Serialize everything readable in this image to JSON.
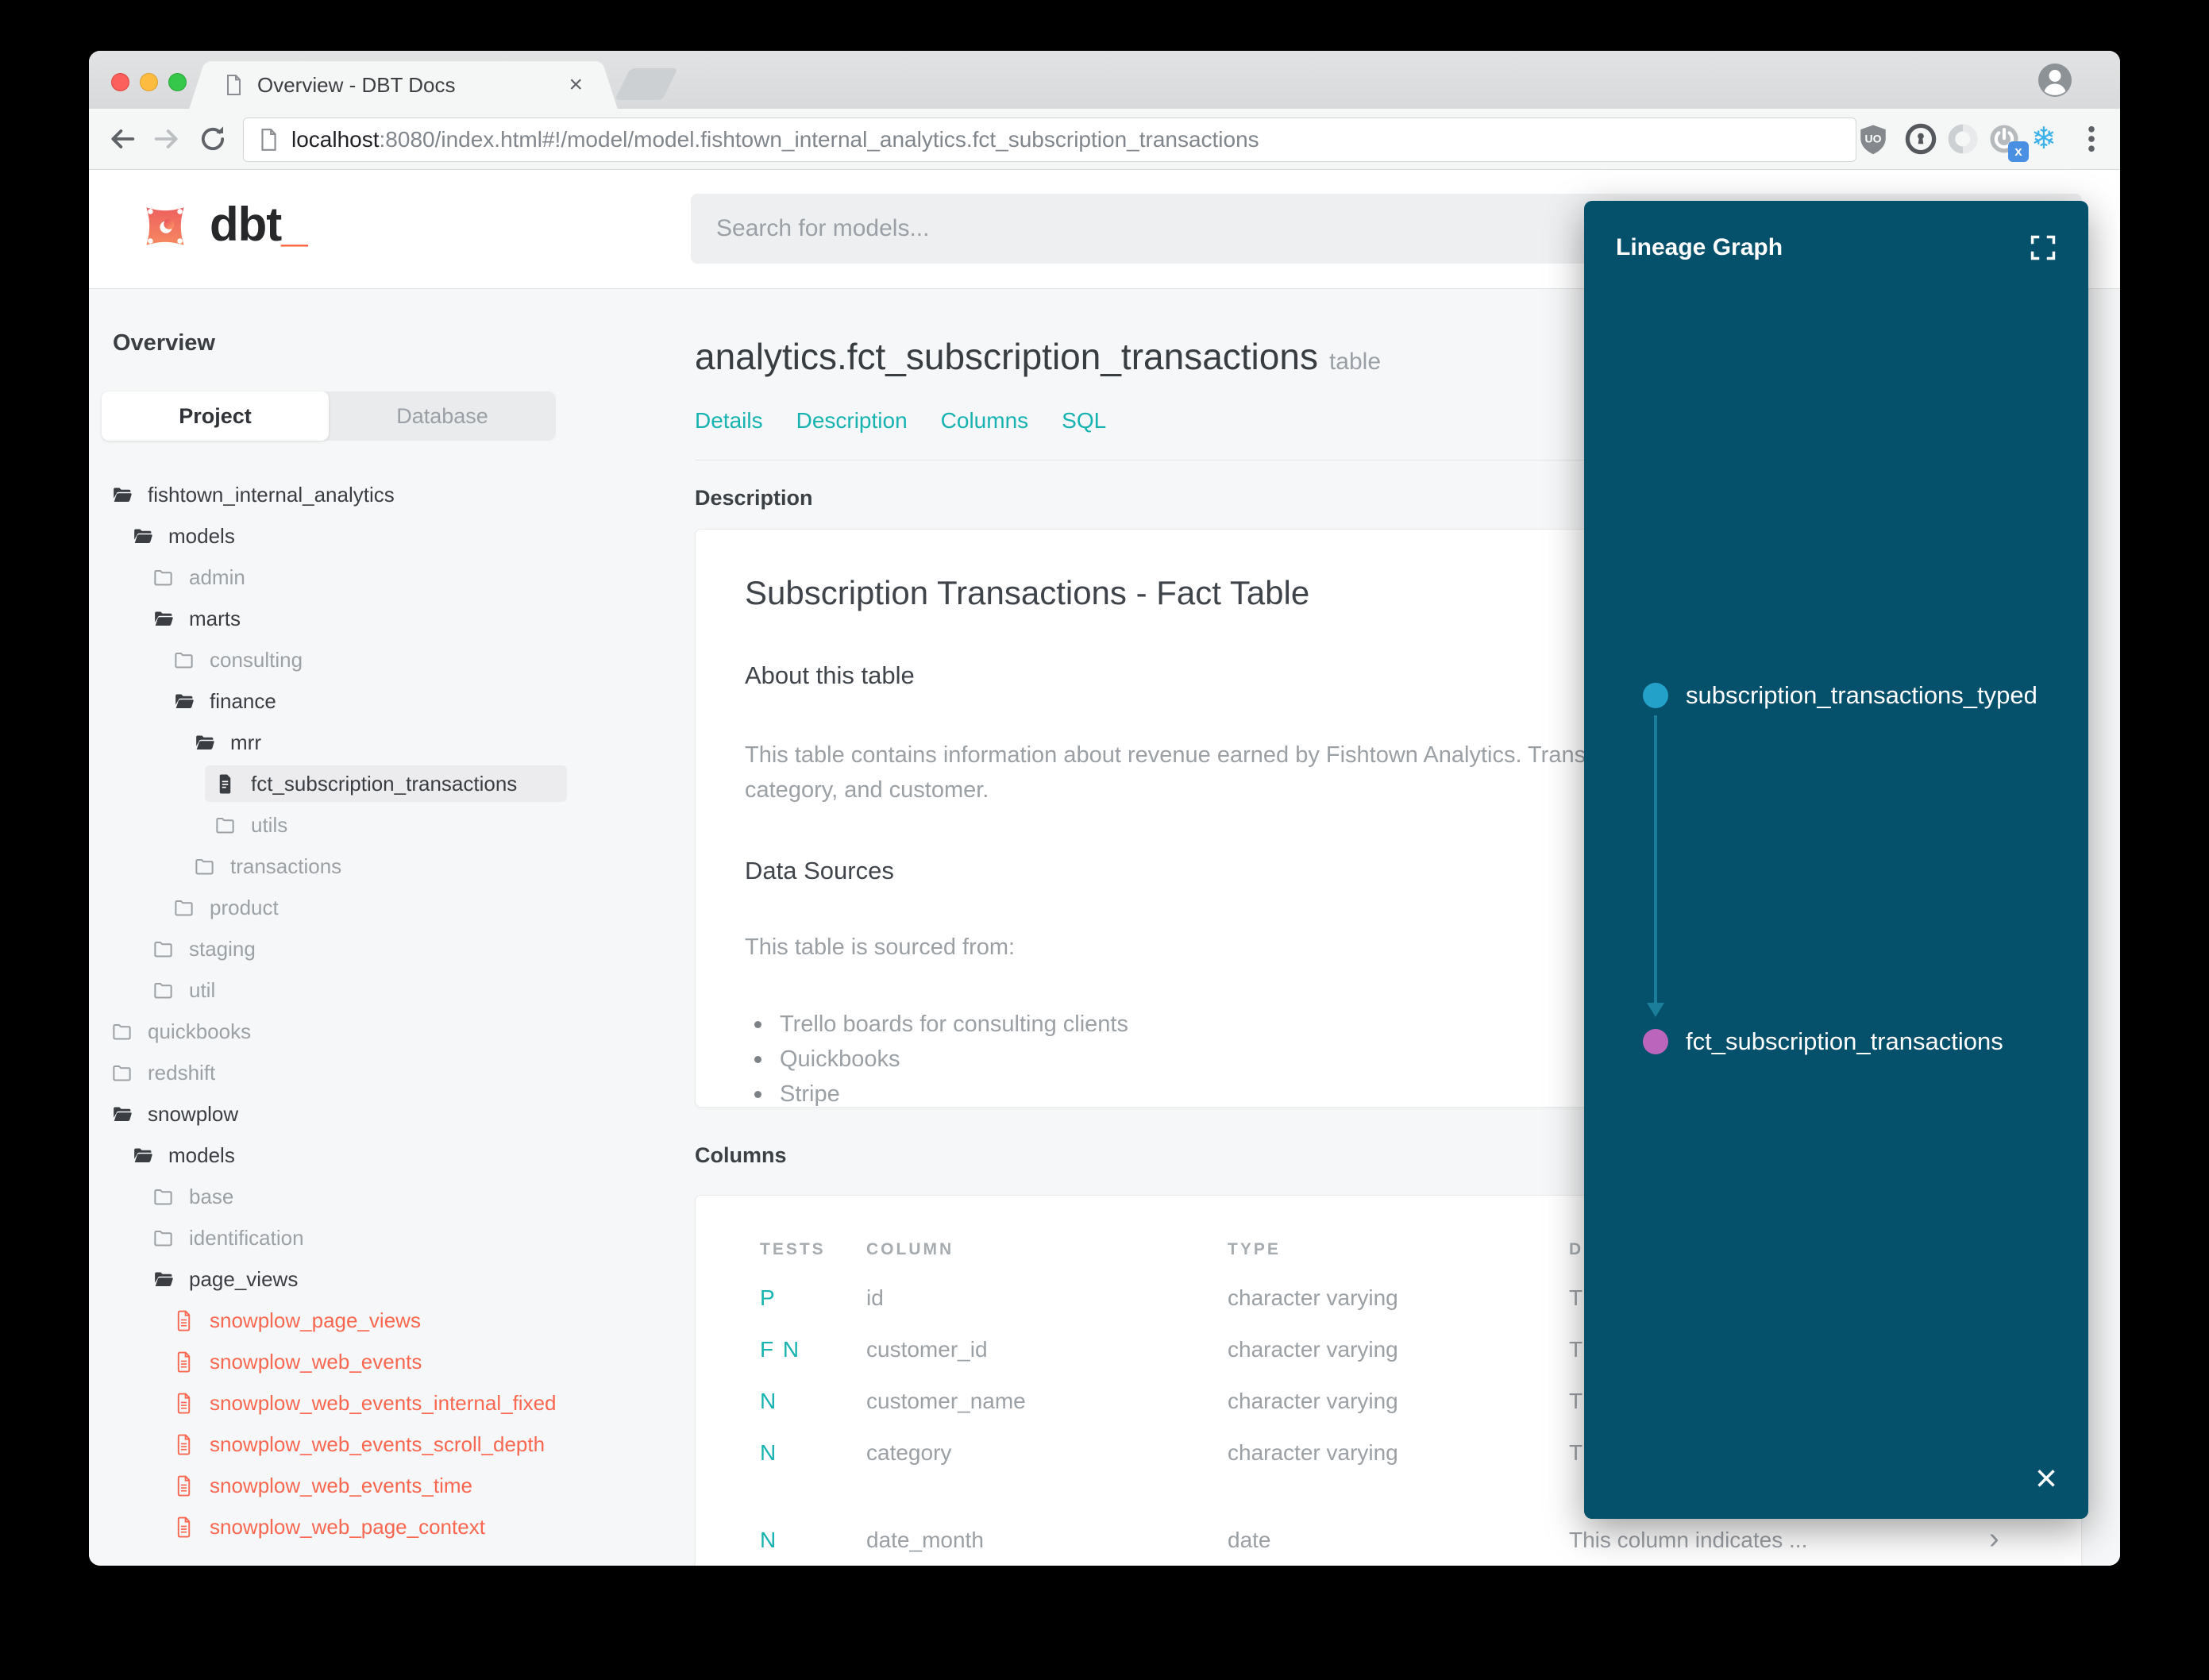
{
  "browser": {
    "tab": {
      "title": "Overview - DBT Docs",
      "close_glyph": "×"
    },
    "url": {
      "host": "localhost",
      "rest": ":8080/index.html#!/model/model.fishtown_internal_analytics.fct_subscription_transactions"
    },
    "extension_icons": [
      "ublock-shield-icon",
      "onepassword-icon",
      "opera-ring-icon",
      "power-blocker-icon",
      "snowflake-icon",
      "overflow-menu-icon"
    ]
  },
  "app": {
    "logo_text": "dbt",
    "logo_cursor": "_",
    "search_placeholder": "Search for models..."
  },
  "sidebar": {
    "heading": "Overview",
    "view_tabs": [
      {
        "label": "Project",
        "active": true
      },
      {
        "label": "Database",
        "active": false
      }
    ],
    "tree": [
      {
        "label": "fishtown_internal_analytics",
        "level": 0,
        "icon": "folder-open",
        "tone": "dark"
      },
      {
        "label": "models",
        "level": 1,
        "icon": "folder-open",
        "tone": "dark"
      },
      {
        "label": "admin",
        "level": 2,
        "icon": "folder",
        "tone": "muted"
      },
      {
        "label": "marts",
        "level": 2,
        "icon": "folder-open",
        "tone": "dark"
      },
      {
        "label": "consulting",
        "level": 3,
        "icon": "folder",
        "tone": "muted"
      },
      {
        "label": "finance",
        "level": 3,
        "icon": "folder-open",
        "tone": "dark"
      },
      {
        "label": "mrr",
        "level": 4,
        "icon": "folder-open",
        "tone": "dark"
      },
      {
        "label": "fct_subscription_transactions",
        "level": 5,
        "icon": "file-solid",
        "tone": "dark",
        "selected": true
      },
      {
        "label": "utils",
        "level": 5,
        "icon": "folder",
        "tone": "muted"
      },
      {
        "label": "transactions",
        "level": 4,
        "icon": "folder",
        "tone": "muted"
      },
      {
        "label": "product",
        "level": 3,
        "icon": "folder",
        "tone": "muted"
      },
      {
        "label": "staging",
        "level": 2,
        "icon": "folder",
        "tone": "muted"
      },
      {
        "label": "util",
        "level": 2,
        "icon": "folder",
        "tone": "muted"
      },
      {
        "label": "quickbooks",
        "level": 0,
        "icon": "folder",
        "tone": "muted"
      },
      {
        "label": "redshift",
        "level": 0,
        "icon": "folder",
        "tone": "muted"
      },
      {
        "label": "snowplow",
        "level": 0,
        "icon": "folder-open",
        "tone": "dark"
      },
      {
        "label": "models",
        "level": 1,
        "icon": "folder-open",
        "tone": "dark"
      },
      {
        "label": "base",
        "level": 2,
        "icon": "folder",
        "tone": "muted"
      },
      {
        "label": "identification",
        "level": 2,
        "icon": "folder",
        "tone": "muted"
      },
      {
        "label": "page_views",
        "level": 2,
        "icon": "folder-open",
        "tone": "dark"
      },
      {
        "label": "snowplow_page_views",
        "level": 3,
        "icon": "file-red",
        "tone": "red"
      },
      {
        "label": "snowplow_web_events",
        "level": 3,
        "icon": "file-red",
        "tone": "red"
      },
      {
        "label": "snowplow_web_events_internal_fixed",
        "level": 3,
        "icon": "file-red",
        "tone": "red"
      },
      {
        "label": "snowplow_web_events_scroll_depth",
        "level": 3,
        "icon": "file-red",
        "tone": "red"
      },
      {
        "label": "snowplow_web_events_time",
        "level": 3,
        "icon": "file-red",
        "tone": "red"
      },
      {
        "label": "snowplow_web_page_context",
        "level": 3,
        "icon": "file-red",
        "tone": "red"
      }
    ]
  },
  "main": {
    "page_title": "analytics.fct_subscription_transactions",
    "page_title_badge": "table",
    "nav_links": [
      "Details",
      "Description",
      "Columns",
      "SQL"
    ],
    "description": {
      "section_heading": "Description",
      "doc_title": "Subscription Transactions - Fact Table",
      "about_heading": "About this table",
      "about_line1": "This table contains information about revenue earned by Fishtown Analytics. Trans",
      "about_line2": "category, and customer.",
      "sources_heading": "Data Sources",
      "sources_intro": "This table is sourced from:",
      "sources_list": [
        "Trello boards for consulting clients",
        "Quickbooks",
        "Stripe"
      ]
    },
    "columns": {
      "section_heading": "Columns",
      "headers": {
        "tests": "TESTS",
        "column": "COLUMN",
        "type": "TYPE",
        "description": "D"
      },
      "rows": [
        {
          "tests": "P",
          "column": "id",
          "type": "character varying",
          "description": "T"
        },
        {
          "tests": "F N",
          "column": "customer_id",
          "type": "character varying",
          "description": "T"
        },
        {
          "tests": "N",
          "column": "customer_name",
          "type": "character varying",
          "description": "T"
        },
        {
          "tests": "N",
          "column": "category",
          "type": "character varying",
          "description": "T"
        },
        {
          "tests": "N",
          "column": "date_month",
          "type": "date",
          "description": "This column indicates ...",
          "chevron": "›",
          "last": true
        }
      ]
    }
  },
  "lineage": {
    "title": "Lineage Graph",
    "close_glyph": "×",
    "nodes": [
      {
        "label": "subscription_transactions_typed",
        "color": "#23a1c9"
      },
      {
        "label": "fct_subscription_transactions",
        "color": "#bb65bd"
      }
    ],
    "edge_color": "#1b7f9c",
    "panel_color": "#05506b"
  },
  "colors": {
    "accent_teal": "#16b3b1",
    "model_red": "#fa6750",
    "logo_orange": "#ff5c35",
    "snowflake_blue": "#3ab1e8",
    "badge_blue": "#4a90e2"
  }
}
